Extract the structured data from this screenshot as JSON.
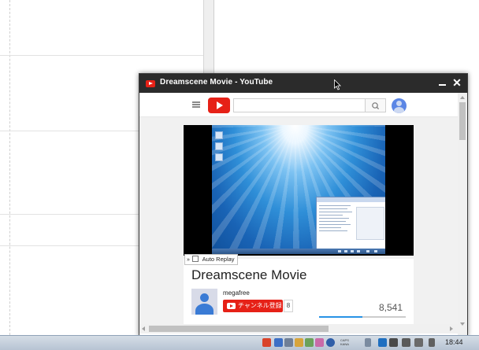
{
  "window": {
    "title": "Dreamscene Movie - YouTube",
    "minimize_icon": "minimize-icon",
    "close_glyph": "✕"
  },
  "youtube": {
    "search_placeholder": "",
    "logo_icon": "youtube-logo-icon",
    "account_icon": "account-avatar-icon"
  },
  "player": {
    "auto_replay_label": "Auto Replay",
    "auto_replay_chevron": "»",
    "auto_replay_checked": false
  },
  "video": {
    "title": "Dreamscene Movie",
    "channel": "megafree",
    "subscribe_label": "チャンネル登録",
    "subscriber_count": "8",
    "views": "8,541",
    "like_ratio": 0.5
  },
  "taskbar": {
    "clock": "18:44",
    "ime_top": "CAPS",
    "ime_bottom": "KANA"
  },
  "colors": {
    "titlebar": "#2b2b2b",
    "youtube_red": "#e62117",
    "accent_blue": "#2793e6"
  }
}
